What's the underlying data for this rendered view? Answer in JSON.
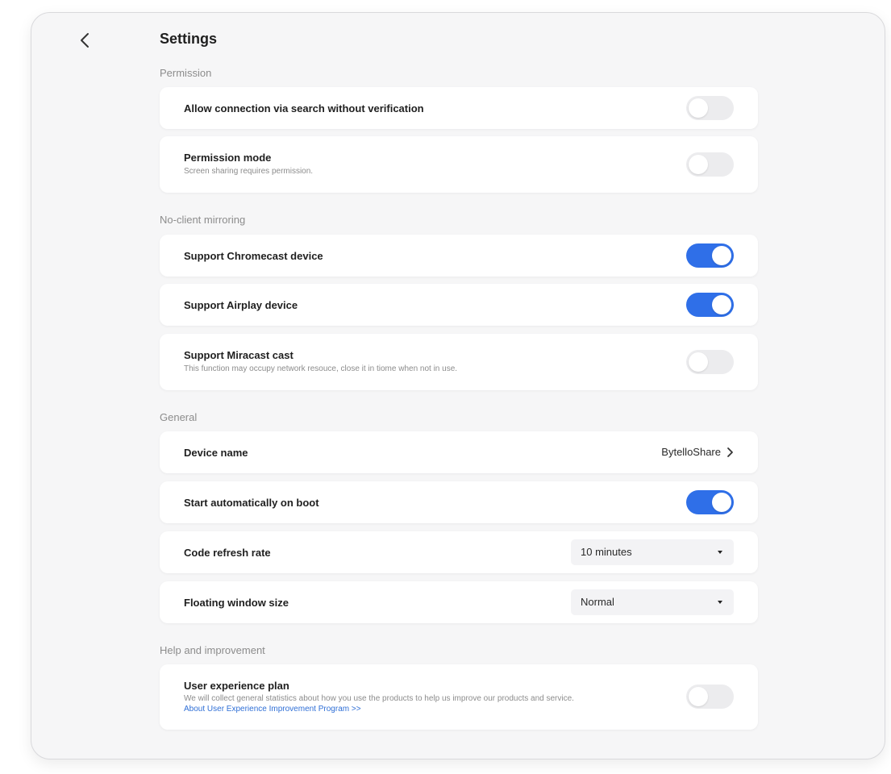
{
  "header": {
    "title": "Settings"
  },
  "sections": {
    "permission": {
      "title": "Permission",
      "allow_connection": {
        "label": "Allow connection via search without verification",
        "enabled": false
      },
      "permission_mode": {
        "label": "Permission mode",
        "description": "Screen sharing requires permission.",
        "enabled": false
      }
    },
    "mirroring": {
      "title": "No-client mirroring",
      "chromecast": {
        "label": "Support Chromecast device",
        "enabled": true
      },
      "airplay": {
        "label": "Support Airplay device",
        "enabled": true
      },
      "miracast": {
        "label": "Support Miracast cast",
        "description": "This function may occupy network resouce, close it in tiome when not in use.",
        "enabled": false
      }
    },
    "general": {
      "title": "General",
      "device_name": {
        "label": "Device name",
        "value": "BytelloShare"
      },
      "auto_start": {
        "label": "Start automatically on boot",
        "enabled": true
      },
      "code_refresh": {
        "label": "Code refresh rate",
        "value": "10 minutes"
      },
      "floating_window": {
        "label": "Floating window size",
        "value": "Normal"
      }
    },
    "help": {
      "title": "Help and improvement",
      "user_experience": {
        "label": "User experience plan",
        "description": "We will collect general statistics about how you use the products to help us improve our products and service.",
        "link": "About User Experience Improvement Program >>",
        "enabled": false
      }
    }
  },
  "colors": {
    "accent": "#2f6fe8",
    "toggle_off": "#ececee",
    "link": "#2f6fd6",
    "background": "#f6f6f7",
    "card": "#ffffff"
  },
  "icons": {
    "back": "chevron-left-icon",
    "device_name_arrow": "chevron-right-icon",
    "dropdown": "caret-down-icon"
  }
}
